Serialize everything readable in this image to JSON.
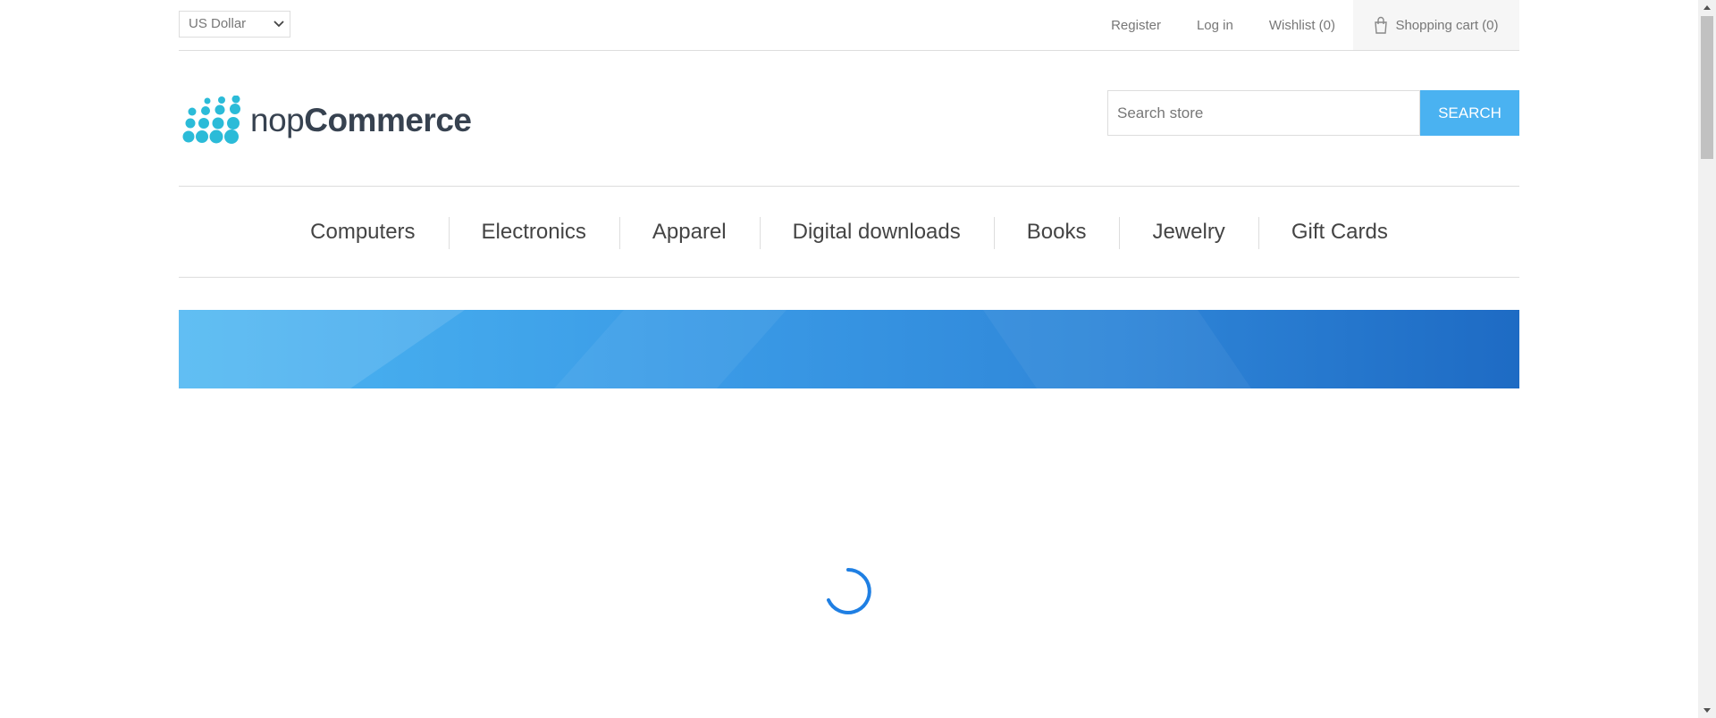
{
  "header": {
    "currency": {
      "selected": "US Dollar"
    },
    "links": {
      "register": "Register",
      "login": "Log in",
      "wishlist": "Wishlist (0)",
      "cart": "Shopping cart (0)"
    }
  },
  "logo": {
    "prefix": "nop",
    "suffix": "Commerce"
  },
  "search": {
    "placeholder": "Search store",
    "button": "Search"
  },
  "nav": {
    "items": [
      "Computers",
      "Electronics",
      "Apparel",
      "Digital downloads",
      "Books",
      "Jewelry",
      "Gift Cards"
    ]
  },
  "colors": {
    "accent": "#4ab2f1",
    "logo_dots": "#2bbbd8",
    "spinner": "#1f7fe3"
  },
  "icons": {
    "cart": "shopping-bag-icon",
    "currency": "chevron-down-icon",
    "spinner": "loading-spinner-icon"
  }
}
